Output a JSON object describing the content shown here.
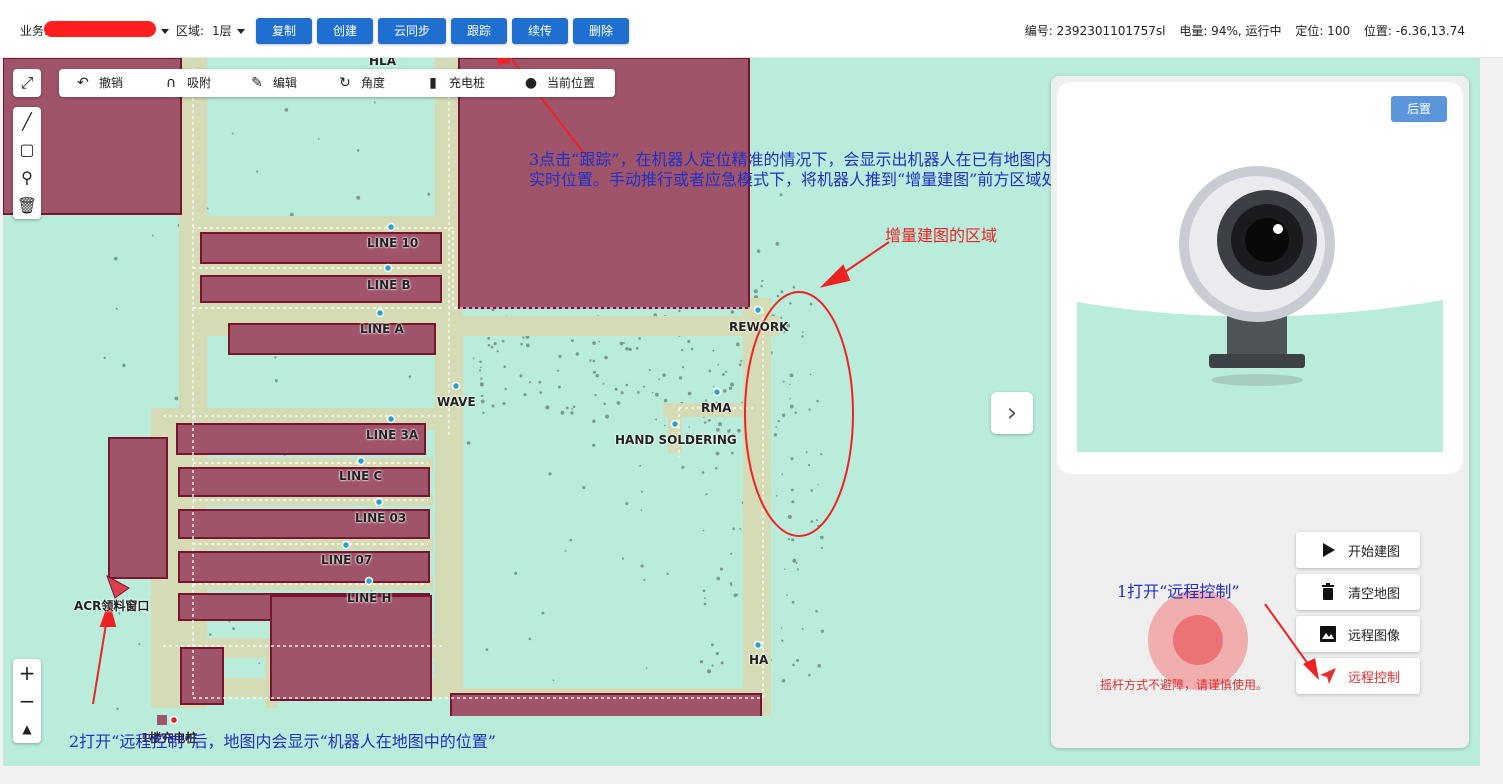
{
  "topbar": {
    "business_label": "业务:",
    "zone_label": "区域:",
    "zone_value": "1层",
    "buttons": [
      "复制",
      "创建",
      "云同步",
      "跟踪",
      "续传",
      "删除"
    ],
    "status": {
      "id": "编号: 2392301101757sl",
      "battery": "电量: 94%, 运行中",
      "localization": "定位: 100",
      "position": "位置: -6.36,13.74"
    }
  },
  "map_toolbar": {
    "undo": "撤销",
    "snap": "吸附",
    "edit": "编辑",
    "angle": "角度",
    "charger": "充电桩",
    "current_position": "当前位置"
  },
  "map_labels": {
    "hla": "HLA",
    "line10": "LINE 10",
    "lineb": "LINE B",
    "linea": "LINE A",
    "rework": "REWORK",
    "wave": "WAVE",
    "rma": "RMA",
    "hand_soldering": "HAND SOLDERING",
    "line3a": "LINE 3A",
    "linec": "LINE C",
    "line03": "LINE 03",
    "line07": "LINE 07",
    "lineh": "LINE H",
    "ha": "HA",
    "acr": "ACR领料窗口",
    "charger": "1楼充电桩"
  },
  "annotations": {
    "step3_line1": "3点击“跟踪”，在机器人定位精准的情况下，会显示出机器人在已有地图内",
    "step3_line2": "实时位置。手动推行或者应急模式下，将机器人推到“增量建图”前方区域处",
    "incremental_area": "增量建图的区域",
    "step1": "1打开“远程控制”",
    "step2": "2打开“远程控制”后，地图内会显示“机器人在地图中的位置”"
  },
  "panel": {
    "rear_button": "后置",
    "start_mapping": "开始建图",
    "clear_map": "清空地图",
    "remote_image": "远程图像",
    "remote_control": "远程控制",
    "joystick_warning": "摇杆方式不避障，请谨慎使用。"
  },
  "colors": {
    "primary_button": "#1e6fd0",
    "map_free": "#b9ecdb",
    "map_obstacle": "#a0546a",
    "map_path": "#d4dcb4",
    "annotation_blue": "#1f2fc8",
    "annotation_red": "#e22222",
    "remote_active": "#e03030"
  },
  "icons": [
    "expand-icon",
    "line-tool-icon",
    "polygon-tool-icon",
    "pin-tool-icon",
    "trash-tool-icon",
    "undo-icon",
    "magnet-icon",
    "pencil-icon",
    "rotate-icon",
    "battery-icon",
    "location-icon",
    "zoom-in-icon",
    "zoom-out-icon",
    "compass-icon",
    "chevron-right-icon",
    "play-icon",
    "trash-icon",
    "image-icon",
    "navigation-arrow-icon",
    "webcam-icon"
  ]
}
